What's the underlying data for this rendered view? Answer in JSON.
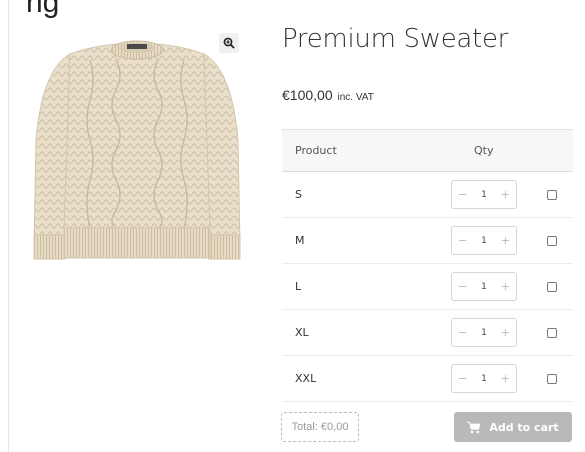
{
  "page": {
    "cut_heading": "ng"
  },
  "product": {
    "title": "Premium Sweater",
    "price": "€100,00",
    "vat_label": "inc. VAT",
    "image_alt": "Cream cable-knit sweater",
    "zoom_icon": "zoom-in-icon"
  },
  "table": {
    "headers": {
      "product": "Product",
      "qty": "Qty"
    },
    "rows": [
      {
        "size": "S",
        "qty": "1",
        "minus": "−",
        "plus": "+"
      },
      {
        "size": "M",
        "qty": "1",
        "minus": "−",
        "plus": "+"
      },
      {
        "size": "L",
        "qty": "1",
        "minus": "−",
        "plus": "+"
      },
      {
        "size": "XL",
        "qty": "1",
        "minus": "−",
        "plus": "+"
      },
      {
        "size": "XXL",
        "qty": "1",
        "minus": "−",
        "plus": "+"
      }
    ]
  },
  "footer": {
    "total": "Total: €0,00",
    "add_to_cart": "Add to cart",
    "cart_icon": "cart-icon"
  },
  "colors": {
    "button_disabled": "#b9b9b9",
    "sweater": "#e9ddc7"
  }
}
